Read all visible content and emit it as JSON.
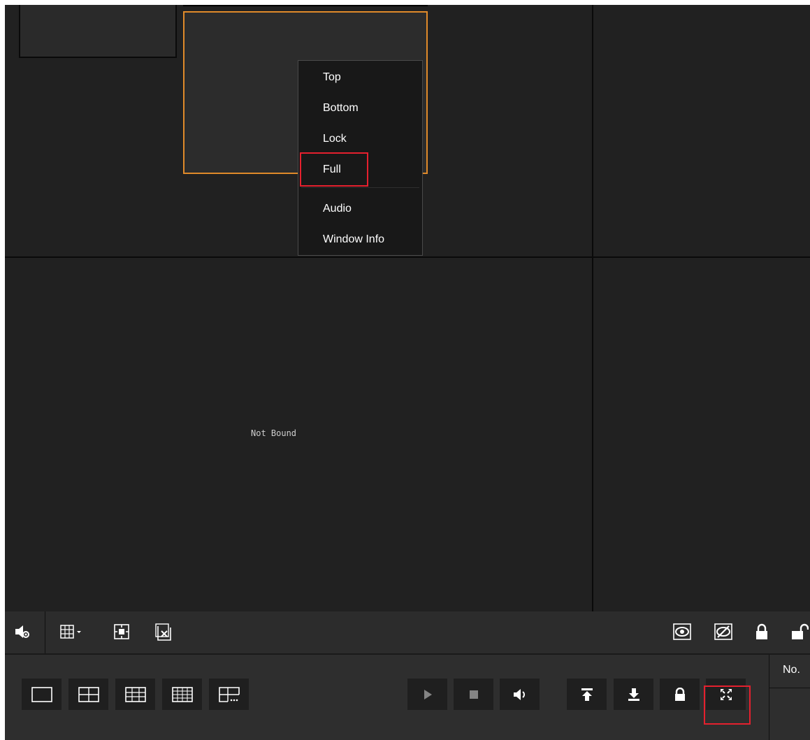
{
  "video_wall": {
    "not_bound_label": "Not Bound",
    "context_menu": {
      "items": [
        {
          "label": "Top"
        },
        {
          "label": "Bottom"
        },
        {
          "label": "Lock"
        },
        {
          "label": "Full"
        },
        {
          "label": "Audio"
        },
        {
          "label": "Window Info"
        }
      ],
      "highlighted": "Full"
    }
  },
  "toolbar": {
    "icons": [
      "audio-settings-icon",
      "grid-layout-dropdown-icon",
      "fit-window-icon",
      "clear-window-icon",
      "show-icon",
      "hide-icon",
      "lock-icon",
      "unlock-icon"
    ]
  },
  "bottom_panel": {
    "layout_buttons": [
      "1x1",
      "2x2",
      "3x3",
      "4x4",
      "custom"
    ],
    "controls": [
      "play",
      "stop",
      "audio",
      "top",
      "bottom",
      "lock",
      "full"
    ],
    "highlighted_control": "full",
    "table": {
      "column_header": "No."
    }
  },
  "colors": {
    "background": "#212121",
    "grid_line": "#0a0a0a",
    "active_window_border": "#e08a2a",
    "highlight": "#e5202e",
    "toolbar": "#2c2c2c"
  }
}
